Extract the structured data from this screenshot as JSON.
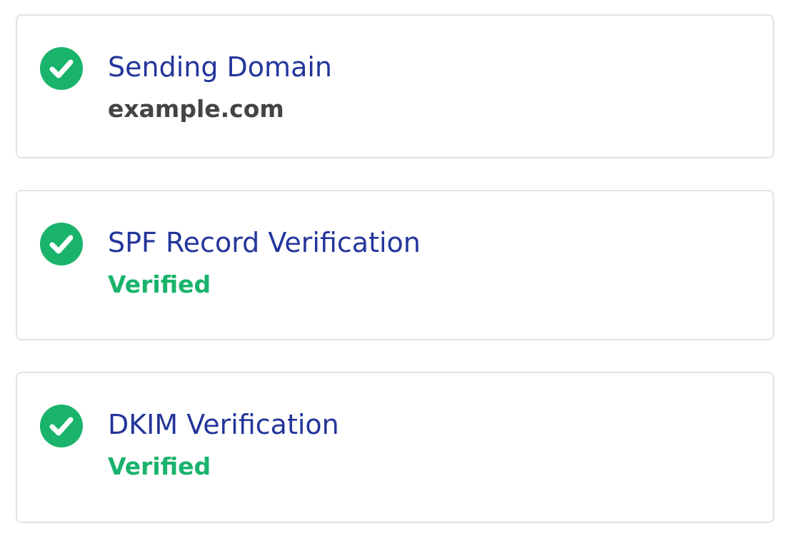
{
  "colors": {
    "title": "#23359b",
    "domain_value": "#444444",
    "verified": "#19b36b",
    "check_icon": "#19b36b",
    "card_border": "#e3e3e3"
  },
  "cards": [
    {
      "icon": "check-circle-icon",
      "title": "Sending Domain",
      "value": "example.com"
    },
    {
      "icon": "check-circle-icon",
      "title": "SPF Record Verification",
      "value": "Verified"
    },
    {
      "icon": "check-circle-icon",
      "title": "DKIM Verification",
      "value": "Verified"
    }
  ]
}
